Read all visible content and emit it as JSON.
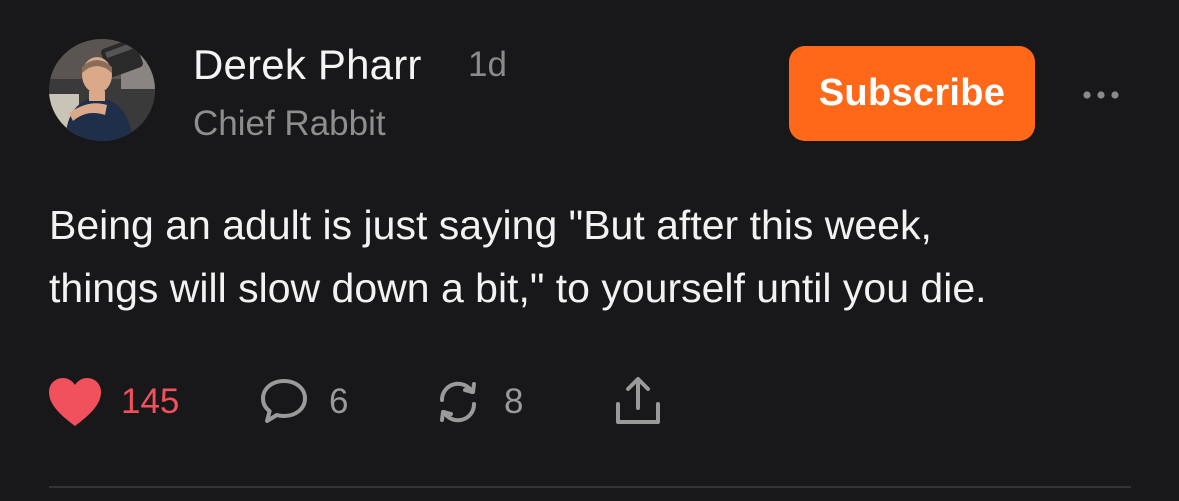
{
  "post": {
    "author": {
      "name": "Derek Pharr",
      "title": "Chief Rabbit",
      "avatar_icon": "user-avatar-photo"
    },
    "time": "1d",
    "subscribe_label": "Subscribe",
    "more_icon": "ellipsis-icon",
    "body": "Being an adult is just saying \"But after this week,\nthings will slow down a bit,\" to yourself until you die.",
    "actions": {
      "likes": "145",
      "comments": "6",
      "restacks": "8"
    }
  },
  "colors": {
    "background": "#18181a",
    "accent": "#ff6719",
    "like": "#f0515c",
    "muted": "#8e8e8e"
  }
}
